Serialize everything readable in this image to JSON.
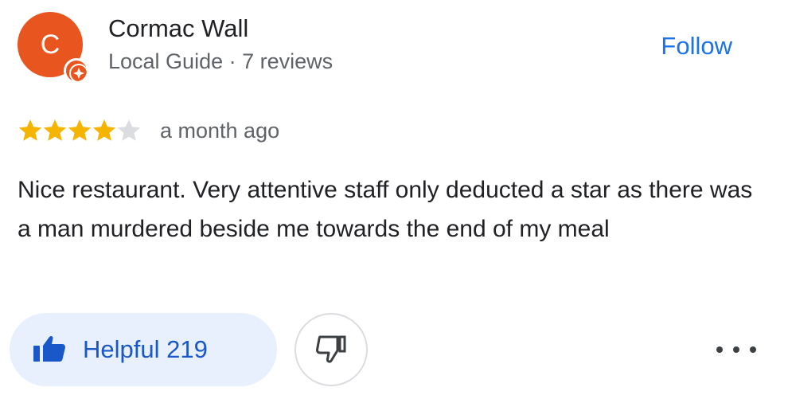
{
  "reviewer": {
    "avatar_initial": "C",
    "name": "Cormac Wall",
    "meta": "Local Guide · 7 reviews",
    "avatar_color": "#e8551f"
  },
  "header": {
    "follow_label": "Follow"
  },
  "rating": {
    "stars": 4,
    "max_stars": 5,
    "filled_color": "#f4b400",
    "empty_color": "#dadce0",
    "time_ago": "a month ago"
  },
  "review": {
    "text": "Nice restaurant. Very attentive staff only deducted a star as there was a man murdered beside me towards the end of my meal"
  },
  "actions": {
    "helpful_label": "Helpful 219",
    "helpful_icon": "thumbs-up-icon",
    "dislike_icon": "thumbs-down-icon",
    "more_icon": "more-horizontal-icon",
    "accent_color": "#1a73e8"
  }
}
